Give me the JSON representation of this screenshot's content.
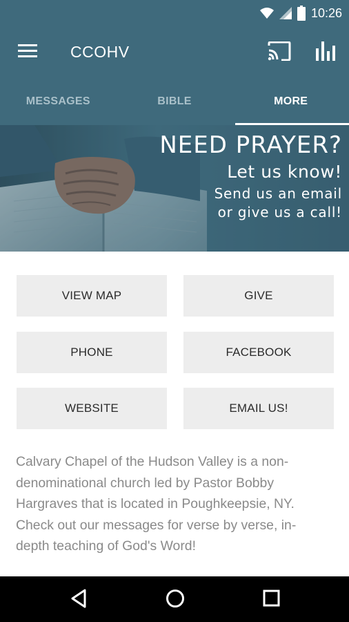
{
  "status_bar": {
    "time": "10:26",
    "icons": [
      "wifi-icon",
      "signal-icon",
      "battery-icon"
    ]
  },
  "app_bar": {
    "title": "CCOHV",
    "icons": [
      "menu-icon",
      "cast-icon",
      "bar-chart-icon"
    ]
  },
  "tabs": [
    {
      "label": "MESSAGES",
      "active": false
    },
    {
      "label": "BIBLE",
      "active": false
    },
    {
      "label": "MORE",
      "active": true
    }
  ],
  "banner": {
    "title": "NEED PRAYER?",
    "subtitle": "Let us know!",
    "line1": "Send us an email",
    "line2": "or give us a call!"
  },
  "buttons": [
    {
      "label": "VIEW MAP"
    },
    {
      "label": "GIVE"
    },
    {
      "label": "PHONE"
    },
    {
      "label": "FACEBOOK"
    },
    {
      "label": "WEBSITE"
    },
    {
      "label": "EMAIL US!"
    }
  ],
  "description": {
    "line1": "Calvary Chapel of the Hudson Valley is a non-",
    "line2": "denominational church led by Pastor Bobby",
    "line3": "Hargraves that is located in Poughkeepsie, NY.",
    "line4": "Check out our messages for verse by verse, in-",
    "line5": "depth teaching of God's Word!"
  },
  "nav_bar": {
    "icons": [
      "back-icon",
      "home-icon",
      "recents-icon"
    ]
  },
  "colors": {
    "primary": "#3f6a7c",
    "tab_inactive": "#a9c0c9",
    "button_bg": "#ededed",
    "description_text": "#8a8a8a"
  }
}
